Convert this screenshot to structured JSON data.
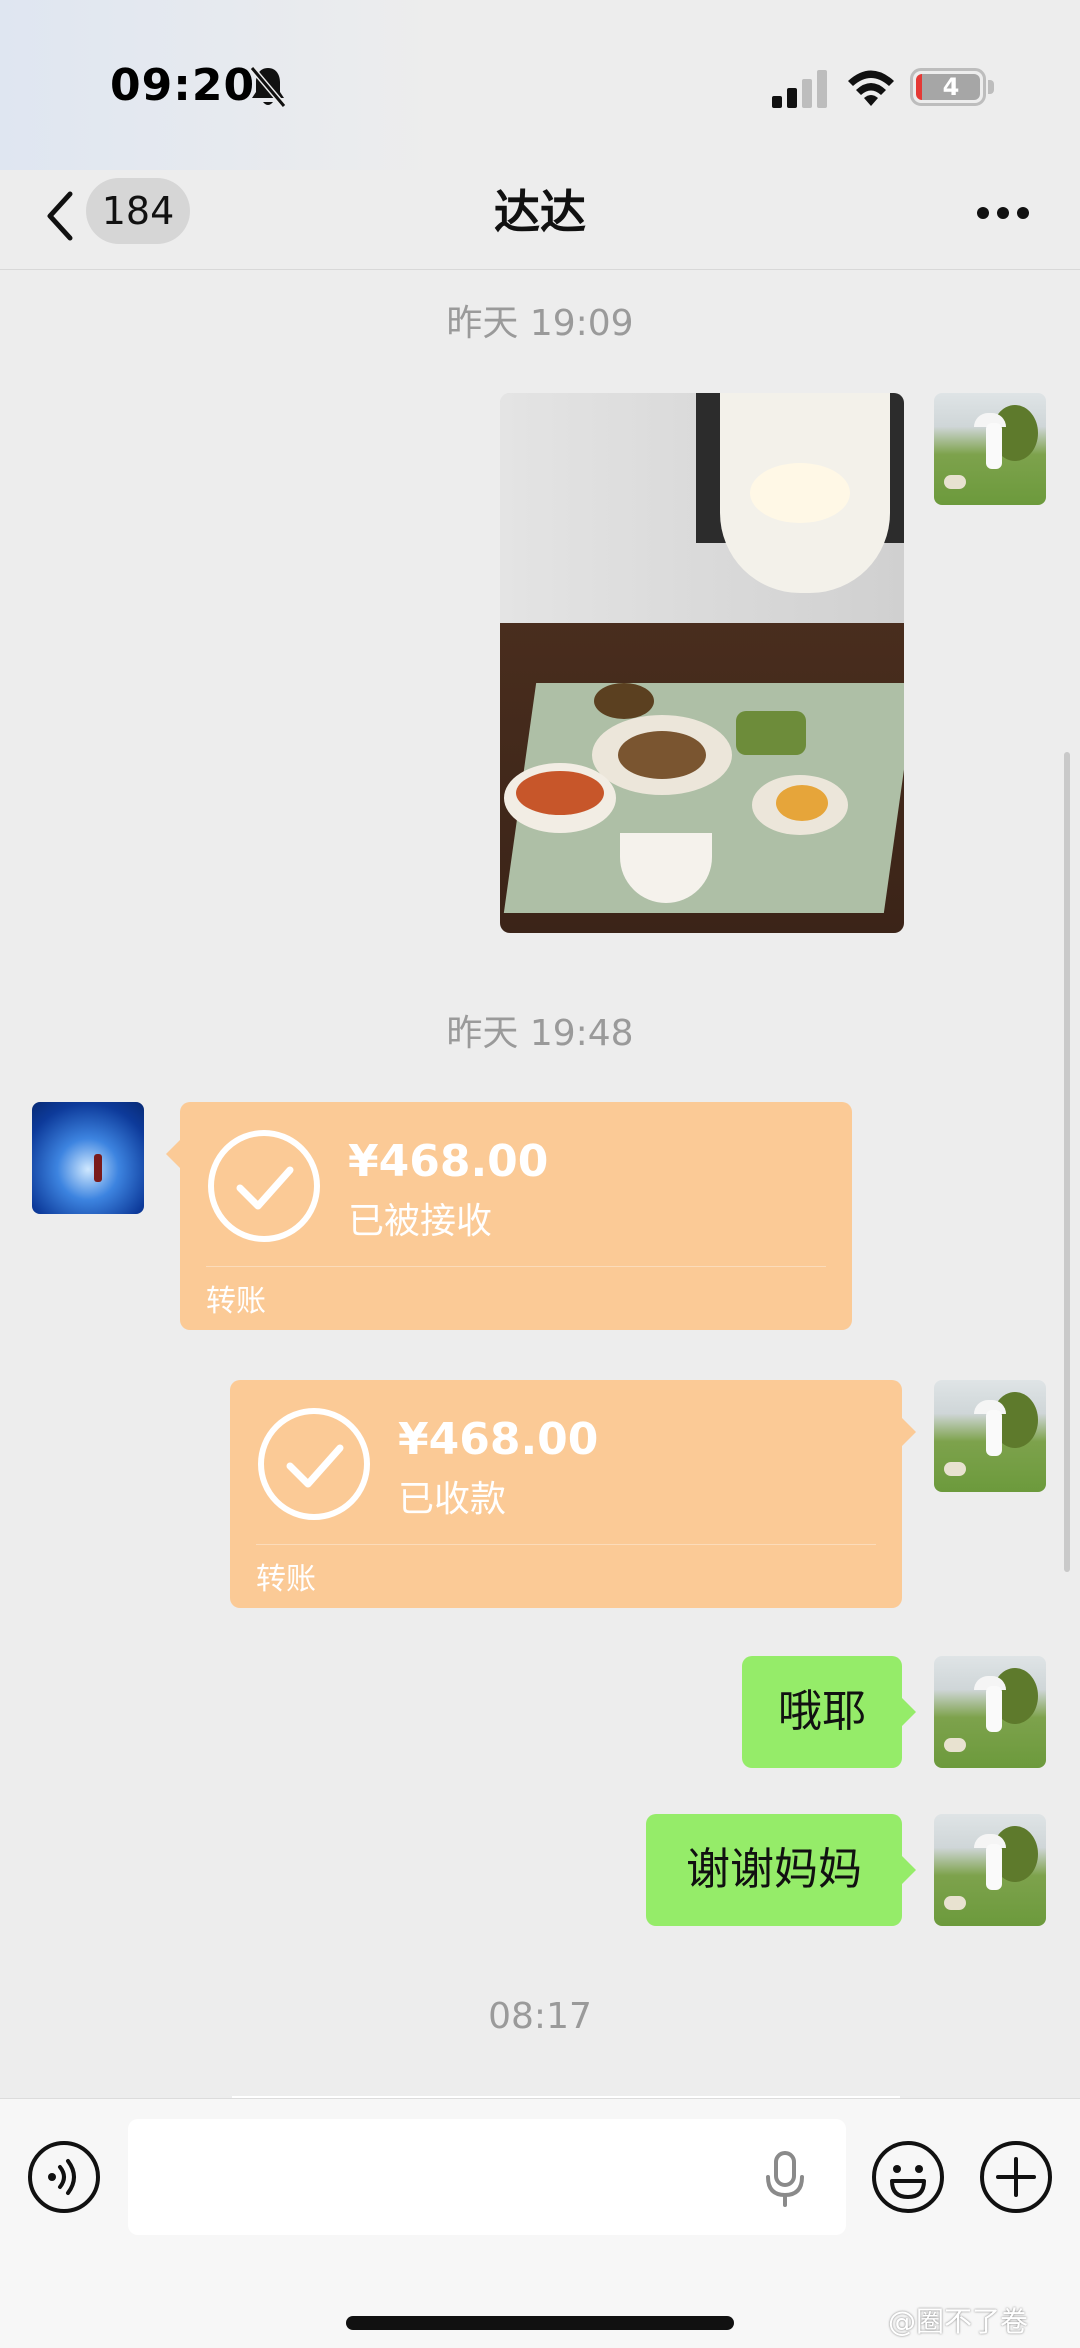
{
  "status_bar": {
    "time": "09:20",
    "battery": "4"
  },
  "nav": {
    "unread_count": "184",
    "title": "达达"
  },
  "messages": {
    "timestamp_1": "昨天 19:09",
    "timestamp_2": "昨天 19:48",
    "timestamp_3": "08:17",
    "transfer_received": {
      "amount": "¥468.00",
      "status": "已被接收",
      "label": "转账"
    },
    "transfer_collected": {
      "amount": "¥468.00",
      "status": "已收款",
      "label": "转账"
    },
    "text_1": "哦耶",
    "text_2": "谢谢妈妈"
  },
  "input": {
    "placeholder": ""
  },
  "watermark": "@圈不了卷",
  "colors": {
    "transfer_card": "#fbca96",
    "sent_bubble": "#95ec69",
    "background": "#ededed"
  }
}
